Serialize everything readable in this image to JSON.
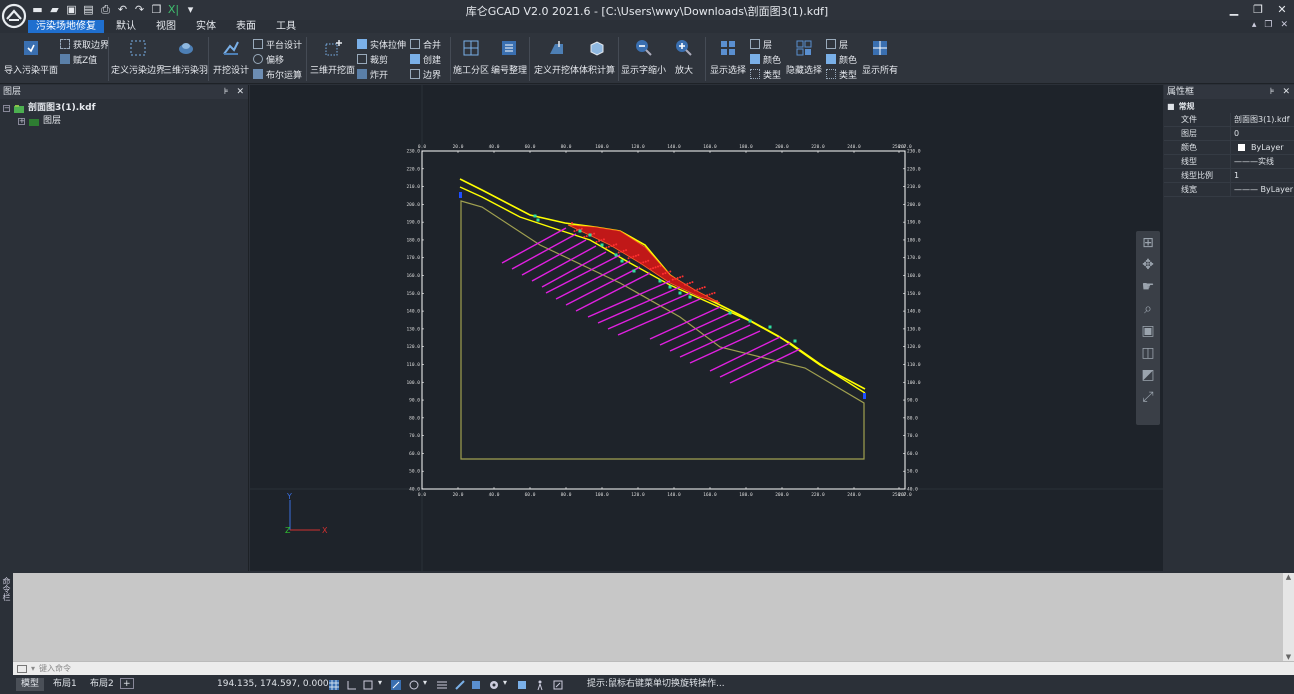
{
  "app": {
    "title": "库仑GCAD V2.0 2021.6 - [C:\\Users\\wwy\\Downloads\\剖面图3(1).kdf]",
    "accent": "#1f6fcf",
    "quick_access_icons": [
      "new-icon",
      "open-icon",
      "save-icon",
      "save-as-icon",
      "print-icon",
      "undo-icon",
      "redo-icon",
      "window-icon",
      "excel-icon",
      "dropdown-icon"
    ],
    "window_buttons": [
      "minimize-icon",
      "restore-icon",
      "close-icon"
    ]
  },
  "ribbon": {
    "tabs": [
      "污染场地修复",
      "默认",
      "视图",
      "实体",
      "表面",
      "工具"
    ],
    "active_tab": 0,
    "groups": {
      "import_plane": "导入污染平面",
      "get_boundary": "获取边界",
      "assign_value": "赋Z值",
      "define_boundary": "定义污染边界",
      "pollution_3d": "三维污染羽",
      "excavation_design": "开挖设计",
      "platform_design": "平台设计",
      "offset": "偏移",
      "boolean": "布尔运算",
      "excavation_3d": "三维开挖面",
      "solid_stretch": "实体拉伸",
      "clip": "裁剪",
      "explode": "炸开",
      "merge": "合并",
      "create": "创建",
      "boundary": "边界",
      "construction_zone": "施工分区",
      "number_sort": "编号整理",
      "define_excavation": "定义开挖体",
      "volume_calc": "体积计算",
      "show_shrink": "显示字缩小",
      "zoom_in": "放大",
      "show_select": "显示选择",
      "layer_a": "层",
      "color_a": "颜色",
      "type_a": "类型",
      "hide_select": "隐藏选择",
      "layer_b": "层",
      "color_b": "颜色",
      "type_b": "类型",
      "show_all": "显示所有"
    }
  },
  "left_panel": {
    "title": "图层",
    "file": "剖面图3(1).kdf",
    "child": "图层"
  },
  "right_panel": {
    "title": "属性框",
    "section": "常规",
    "rows": [
      {
        "k": "文件",
        "v": "剖面图3(1).kdf"
      },
      {
        "k": "图层",
        "v": "0"
      },
      {
        "k": "颜色",
        "v": "ByLayer"
      },
      {
        "k": "线型",
        "v": "———实线"
      },
      {
        "k": "线型比例",
        "v": "1"
      },
      {
        "k": "线宽",
        "v": "——— ByLayer"
      }
    ]
  },
  "chart_data": {
    "type": "line",
    "x_ticks": [
      "0.0",
      "20.0",
      "40.0",
      "60.0",
      "80.0",
      "100.0",
      "120.0",
      "140.0",
      "160.0",
      "180.0",
      "200.0",
      "220.0",
      "240.0",
      "250.0",
      "267.0"
    ],
    "y_ticks": [
      "230.0",
      "220.0",
      "210.0",
      "200.0",
      "190.0",
      "180.0",
      "170.0",
      "160.0",
      "150.0",
      "140.0",
      "130.0",
      "120.0",
      "110.0",
      "100.0",
      "90.0",
      "80.0",
      "70.0",
      "60.0",
      "50.0",
      "40.0"
    ],
    "colors": {
      "ground": "#ffff00",
      "bedrock": "#a0a050",
      "bolts": "#e020e0",
      "mesh": "#d42020",
      "points": "#30e0a0",
      "frame": "#ffffff"
    }
  },
  "axes_gizmo": {
    "x": "X",
    "y": "Y",
    "z": "Z"
  },
  "nav_tools": [
    "pan-icon",
    "orbit-icon",
    "free-orbit-icon",
    "zoom-icon",
    "front-view-icon",
    "side-view-icon",
    "iso-view-icon",
    "extents-icon"
  ],
  "command": {
    "side_label": "命令栏",
    "placeholder": "键入命令"
  },
  "status": {
    "tabs": [
      "模型",
      "布局1",
      "布局2"
    ],
    "add": "+",
    "coords": "194.135, 174.597, 0.000",
    "hint": "提示:鼠标右键菜单切换旋转操作..."
  }
}
